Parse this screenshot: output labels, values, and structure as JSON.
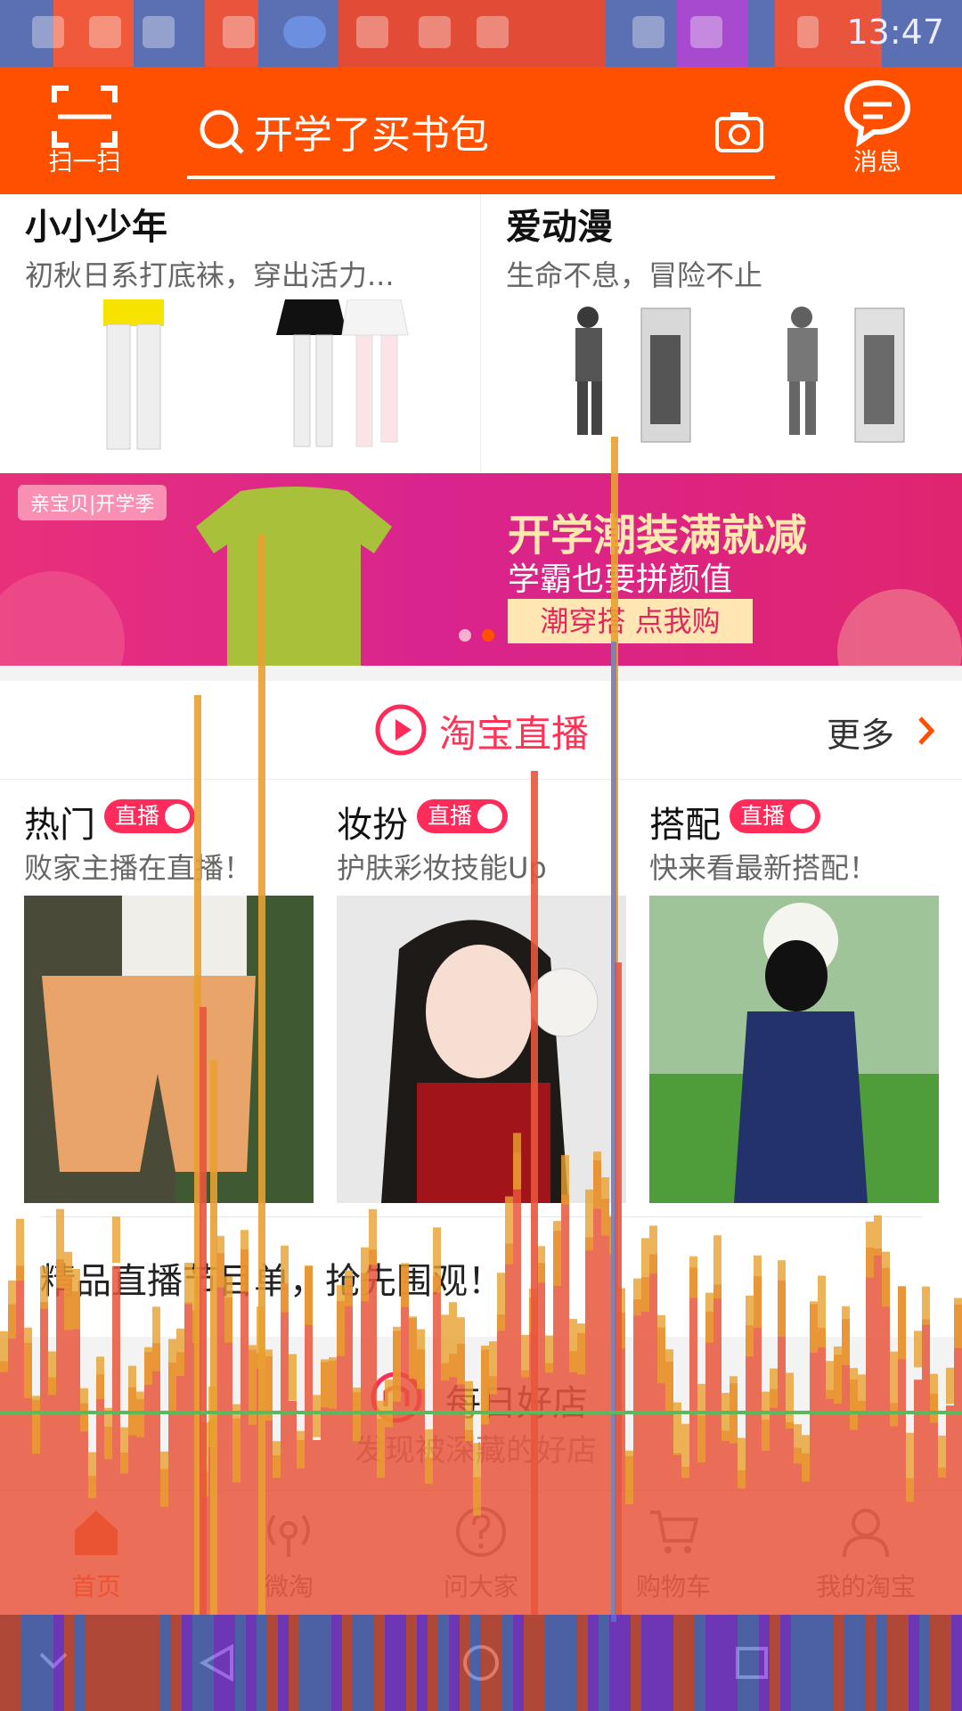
{
  "status_bar": {
    "time": "13:47",
    "icons": [
      "sim-icon",
      "image-icon",
      "image-icon",
      "image-icon",
      "usb-icon",
      "baidu-icon",
      "shield-icon",
      "alert-icon",
      "download-icon",
      "android-icon",
      "vibrate-icon",
      "wifi-icon",
      "battery-icon"
    ]
  },
  "header": {
    "scan_label": "扫一扫",
    "search_placeholder": "开学了买书包",
    "message_label": "消息"
  },
  "categories": [
    {
      "title": "小小少年",
      "subtitle": "初秋日系打底袜，穿出活力..."
    },
    {
      "title": "爱动漫",
      "subtitle": "生命不息，冒险不止"
    }
  ],
  "banner": {
    "tag": "亲宝贝|开学季",
    "title": "开学潮装满就减",
    "subtitle": "学霸也要拼颜值",
    "button": "潮穿搭 点我购"
  },
  "live": {
    "title": "淘宝直播",
    "more": "更多",
    "badge": "直播",
    "cards": [
      {
        "category": "热门",
        "desc": "败家主播在直播！"
      },
      {
        "category": "妆扮",
        "desc": "护肤彩妆技能Up"
      },
      {
        "category": "搭配",
        "desc": "快来看最新搭配！"
      }
    ],
    "schedule": "精品直播节目单，抢先围观！"
  },
  "shop": {
    "title": "每日好店",
    "subtitle": "发现被深藏的好店"
  },
  "tabs": [
    {
      "label": "首页",
      "icon": "home-icon"
    },
    {
      "label": "微淘",
      "icon": "broadcast-icon"
    },
    {
      "label": "问大家",
      "icon": "question-icon"
    },
    {
      "label": "购物车",
      "icon": "cart-icon"
    },
    {
      "label": "我的淘宝",
      "icon": "user-icon"
    }
  ],
  "colors": {
    "brand": "#ff5000",
    "live": "#ff2b5a",
    "overlay_red": "#e8553c",
    "overlay_orange": "#e8a030",
    "overlay_blue": "#5b78d8",
    "overlay_purple": "#8a3cf0"
  }
}
